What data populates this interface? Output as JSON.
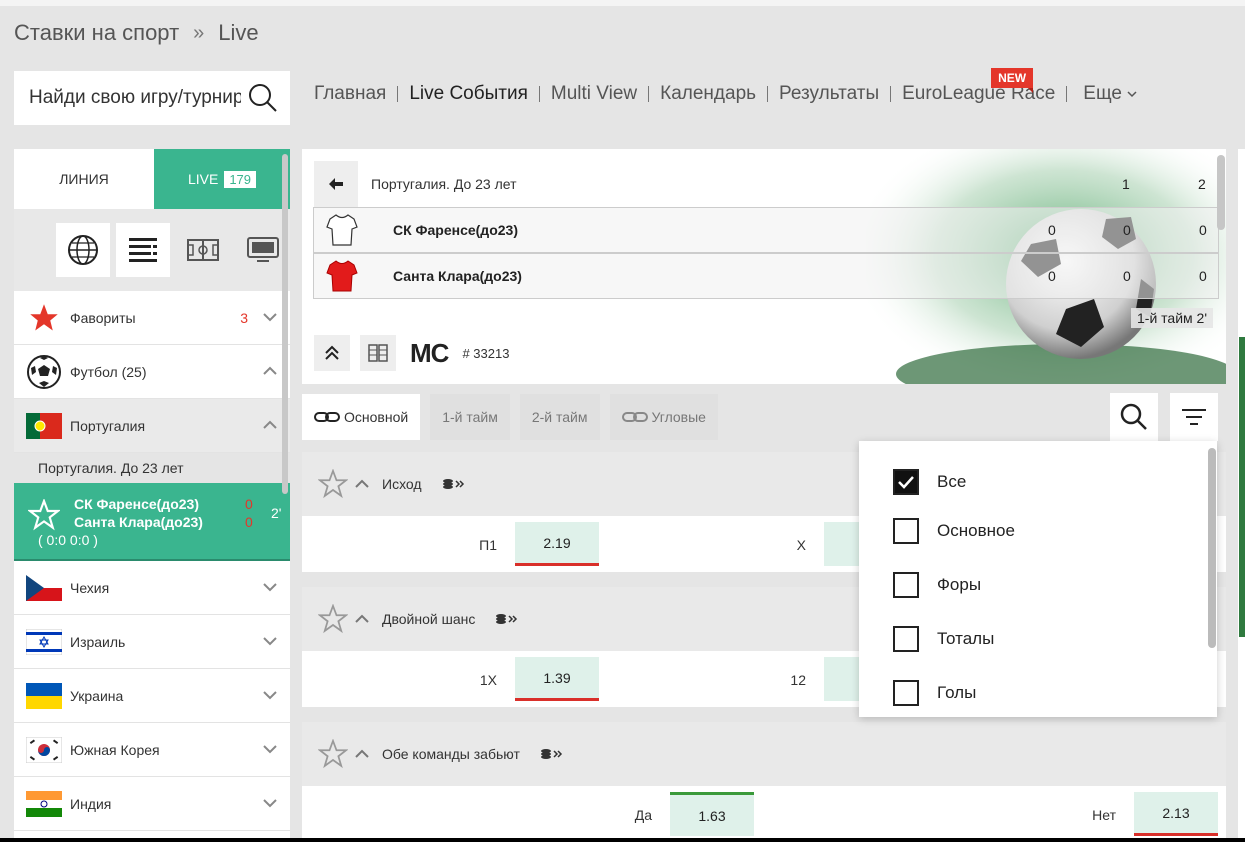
{
  "breadcrumb": {
    "root": "Ставки на спорт",
    "sep": "»",
    "current": "Live"
  },
  "search": {
    "placeholder": "Найди свою игру/турнир"
  },
  "topnav": {
    "items": [
      "Главная",
      "Live События",
      "Multi View",
      "Календарь",
      "Результаты",
      "EuroLeague Race",
      "Еще"
    ],
    "new_badge": "NEW"
  },
  "sidebar": {
    "tab_line": "ЛИНИЯ",
    "tab_live": "LIVE",
    "live_count": "179",
    "favorites": {
      "label": "Фавориты",
      "count": "3"
    },
    "football": {
      "label": "Футбол (25)"
    },
    "portugal": {
      "label": "Португалия"
    },
    "league": "Португалия. До 23 лет",
    "match": {
      "team1": "СК Фаренсе(до23)",
      "team2": "Санта Клара(до23)",
      "score1": "0",
      "score2": "0",
      "time": "2'",
      "half_scores": "( 0:0   0:0 )"
    },
    "countries": [
      "Чехия",
      "Израиль",
      "Украина",
      "Южная Корея",
      "Индия"
    ]
  },
  "scoreboard": {
    "league": "Португалия. До 23 лет",
    "col1": "1",
    "col2": "2",
    "team1": {
      "name": "СК Фаренсе(до23)",
      "total": "0",
      "p1": "0",
      "p2": "0"
    },
    "team2": {
      "name": "Санта Клара(до23)",
      "total": "0",
      "p1": "0",
      "p2": "0"
    },
    "period": "1-й тайм  2'",
    "mc": "MC",
    "match_id": "# 33213"
  },
  "market_tabs": [
    "Основной",
    "1-й тайм",
    "2-й тайм",
    "Угловые"
  ],
  "markets": {
    "outcome": {
      "title": "Исход",
      "l1": "П1",
      "o1": "2.19",
      "l2": "Х"
    },
    "double": {
      "title": "Двойной шанс",
      "l1": "1Х",
      "o1": "1.39",
      "l2": "12"
    },
    "both": {
      "title": "Обе команды забьют",
      "l1": "Да",
      "o1": "1.63",
      "l2": "Нет",
      "o2": "2.13"
    }
  },
  "filter": {
    "items": [
      "Все",
      "Основное",
      "Форы",
      "Тоталы",
      "Голы"
    ],
    "checked": "Все"
  },
  "colors": {
    "accent": "#3ab58f",
    "red": "#e4362a",
    "odd_bg": "#dff1ea"
  }
}
